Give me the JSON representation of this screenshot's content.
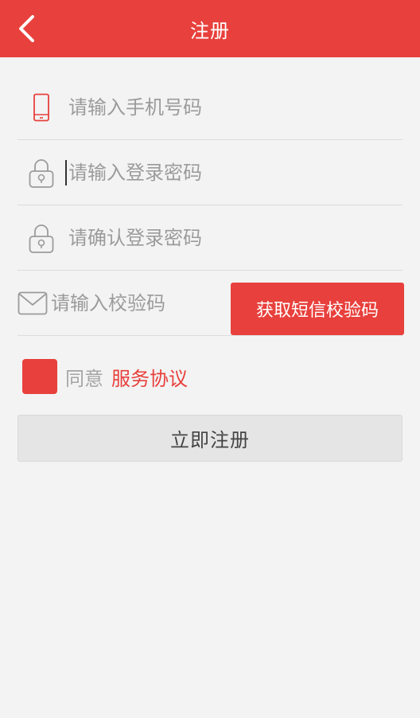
{
  "header": {
    "title": "注册",
    "back_icon": "chevron-left-icon"
  },
  "colors": {
    "accent": "#e8403c",
    "background": "#f3f3f3",
    "placeholder": "#9b9b9b",
    "divider": "#dcdcdc"
  },
  "form": {
    "phone": {
      "icon": "phone-icon",
      "placeholder": "请输入手机号码",
      "value": ""
    },
    "password": {
      "icon": "lock-icon",
      "placeholder": "请输入登录密码",
      "value": ""
    },
    "confirm_password": {
      "icon": "lock-icon",
      "placeholder": "请确认登录密码",
      "value": ""
    },
    "code": {
      "icon": "mail-icon",
      "placeholder": "请输入校验码",
      "value": ""
    },
    "get_code_label": "获取短信校验码"
  },
  "agreement": {
    "checked": true,
    "prefix": "同意",
    "link_label": "服务协议"
  },
  "submit_label": "立即注册"
}
